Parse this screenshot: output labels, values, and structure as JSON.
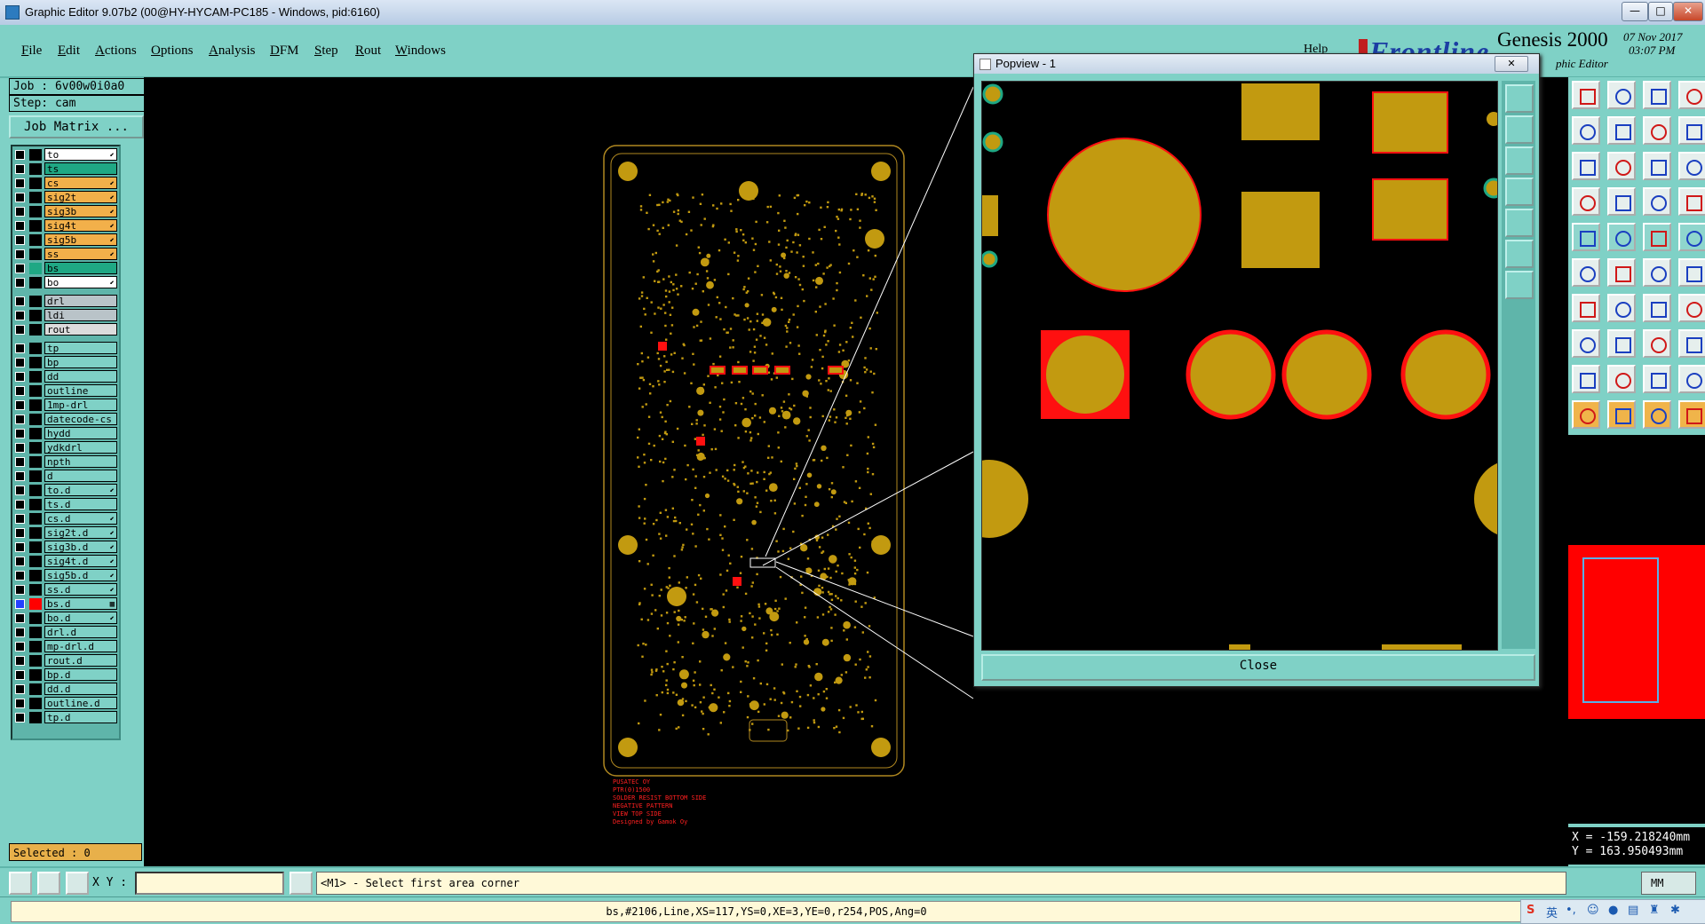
{
  "window": {
    "title": "Graphic Editor 9.07b2 (00@HY-HYCAM-PC185 - Windows, pid:6160)",
    "controls": {
      "minimize": "—",
      "maximize": "□",
      "close": "✕"
    }
  },
  "menu": {
    "items": [
      "File",
      "Edit",
      "Actions",
      "Options",
      "Analysis",
      "DFM",
      "Step",
      "Rout",
      "Windows"
    ],
    "help": "Help"
  },
  "brand": {
    "logo": "Frontline",
    "product": "Genesis 2000",
    "subtitle": "phic Editor",
    "date": "07 Nov 2017",
    "time": "03:07 PM"
  },
  "job": {
    "job_label": "Job : 6v00w0i0a0",
    "step_label": "Step: cam",
    "matrix_button": "Job Matrix ..."
  },
  "layers": [
    {
      "name": "to",
      "color": "#ffffff",
      "sw": "#000000",
      "checked": false,
      "arrow": "⬋"
    },
    {
      "name": "ts",
      "color": "#1fa884",
      "sw": "#000000",
      "checked": false,
      "arrow": ""
    },
    {
      "name": "cs",
      "color": "#f2b04a",
      "sw": "#000000",
      "checked": false,
      "arrow": "⬋"
    },
    {
      "name": "sig2t",
      "color": "#f2b04a",
      "sw": "#000000",
      "checked": false,
      "arrow": "⬋"
    },
    {
      "name": "sig3b",
      "color": "#f2b04a",
      "sw": "#000000",
      "checked": false,
      "arrow": "⬋"
    },
    {
      "name": "sig4t",
      "color": "#f2b04a",
      "sw": "#000000",
      "checked": false,
      "arrow": "⬋"
    },
    {
      "name": "sig5b",
      "color": "#f2b04a",
      "sw": "#000000",
      "checked": false,
      "arrow": "⬋"
    },
    {
      "name": "ss",
      "color": "#f2b04a",
      "sw": "#000000",
      "checked": false,
      "arrow": "⬋"
    },
    {
      "name": "bs",
      "color": "#1fa884",
      "sw": "#1fa884",
      "checked": false,
      "arrow": ""
    },
    {
      "name": "bo",
      "color": "#ffffff",
      "sw": "#000000",
      "checked": false,
      "arrow": "⬋"
    },
    {
      "name": "drl",
      "color": "#b9c3c8",
      "sw": "#000000",
      "checked": false,
      "arrow": "",
      "gap": true
    },
    {
      "name": "ldi",
      "color": "#b9c3c8",
      "sw": "#000000",
      "checked": false,
      "arrow": ""
    },
    {
      "name": "rout",
      "color": "#dcdcdc",
      "sw": "#000000",
      "checked": false,
      "arrow": ""
    },
    {
      "name": "tp",
      "color": "#7fd1c6",
      "sw": "#000000",
      "checked": false,
      "arrow": "",
      "gap": true
    },
    {
      "name": "bp",
      "color": "#7fd1c6",
      "sw": "#000000",
      "checked": false,
      "arrow": ""
    },
    {
      "name": "dd",
      "color": "#7fd1c6",
      "sw": "#000000",
      "checked": false,
      "arrow": ""
    },
    {
      "name": "outline",
      "color": "#7fd1c6",
      "sw": "#000000",
      "checked": false,
      "arrow": ""
    },
    {
      "name": "1mp-drl",
      "color": "#7fd1c6",
      "sw": "#000000",
      "checked": false,
      "arrow": ""
    },
    {
      "name": "datecode-cs",
      "color": "#7fd1c6",
      "sw": "#000000",
      "checked": false,
      "arrow": ""
    },
    {
      "name": "hydd",
      "color": "#7fd1c6",
      "sw": "#000000",
      "checked": false,
      "arrow": ""
    },
    {
      "name": "ydkdrl",
      "color": "#7fd1c6",
      "sw": "#000000",
      "checked": false,
      "arrow": ""
    },
    {
      "name": "npth",
      "color": "#7fd1c6",
      "sw": "#000000",
      "checked": false,
      "arrow": ""
    },
    {
      "name": "d",
      "color": "#7fd1c6",
      "sw": "#000000",
      "checked": false,
      "arrow": ""
    },
    {
      "name": "to.d",
      "color": "#7fd1c6",
      "sw": "#000000",
      "checked": false,
      "arrow": "⬋"
    },
    {
      "name": "ts.d",
      "color": "#7fd1c6",
      "sw": "#000000",
      "checked": false,
      "arrow": ""
    },
    {
      "name": "cs.d",
      "color": "#7fd1c6",
      "sw": "#000000",
      "checked": false,
      "arrow": "⬋"
    },
    {
      "name": "sig2t.d",
      "color": "#7fd1c6",
      "sw": "#000000",
      "checked": false,
      "arrow": "⬋"
    },
    {
      "name": "sig3b.d",
      "color": "#7fd1c6",
      "sw": "#000000",
      "checked": false,
      "arrow": "⬋"
    },
    {
      "name": "sig4t.d",
      "color": "#7fd1c6",
      "sw": "#000000",
      "checked": false,
      "arrow": "⬋"
    },
    {
      "name": "sig5b.d",
      "color": "#7fd1c6",
      "sw": "#000000",
      "checked": false,
      "arrow": "⬋"
    },
    {
      "name": "ss.d",
      "color": "#7fd1c6",
      "sw": "#000000",
      "checked": false,
      "arrow": "⬋"
    },
    {
      "name": "bs.d",
      "color": "#7fd1c6",
      "sw": "#ff0000",
      "checked": true,
      "arrow": "▦"
    },
    {
      "name": "bo.d",
      "color": "#7fd1c6",
      "sw": "#000000",
      "checked": false,
      "arrow": "⬋"
    },
    {
      "name": "drl.d",
      "color": "#7fd1c6",
      "sw": "#000000",
      "checked": false,
      "arrow": ""
    },
    {
      "name": "mp-drl.d",
      "color": "#7fd1c6",
      "sw": "#000000",
      "checked": false,
      "arrow": ""
    },
    {
      "name": "rout.d",
      "color": "#7fd1c6",
      "sw": "#000000",
      "checked": false,
      "arrow": ""
    },
    {
      "name": "bp.d",
      "color": "#7fd1c6",
      "sw": "#000000",
      "checked": false,
      "arrow": ""
    },
    {
      "name": "dd.d",
      "color": "#7fd1c6",
      "sw": "#000000",
      "checked": false,
      "arrow": ""
    },
    {
      "name": "outline.d",
      "color": "#7fd1c6",
      "sw": "#000000",
      "checked": false,
      "arrow": ""
    },
    {
      "name": "tp.d",
      "color": "#7fd1c6",
      "sw": "#000000",
      "checked": false,
      "arrow": ""
    }
  ],
  "selected": "Selected : 0",
  "board_text": [
    "PUSATEC OY",
    "PTR(0)1500",
    "SOLDER RESIST BOTTOM SIDE",
    "NEGATIVE PATTERN",
    "VIEW TOP SIDE",
    "Designed by Gamok Oy"
  ],
  "popview": {
    "title": "Popview - 1",
    "close_button": "Close",
    "close_x": "✕"
  },
  "colors": {
    "pad": "#c29a10",
    "resist": "#ff1010",
    "outline": "#b08820",
    "bg": "#000000",
    "panel": "#7fd1c6"
  },
  "coords": {
    "x": "X = -159.218240mm",
    "y": "Y = 163.950493mm"
  },
  "bottom": {
    "xy_label": "X Y :",
    "xy_value": "",
    "prompt": "<M1> - Select first area corner",
    "units": "MM"
  },
  "status": "bs,#2106,Line,XS=117,YS=0,XE=3,YE=0,r254,POS,Ang=0",
  "tray": {
    "ime": "英"
  }
}
